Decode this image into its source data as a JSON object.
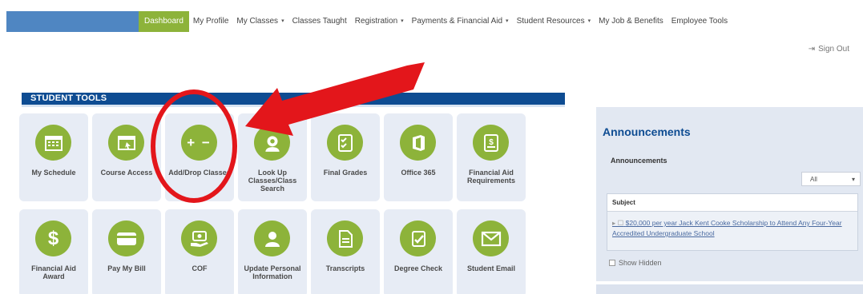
{
  "nav": {
    "items": [
      {
        "label": "Dashboard",
        "active": true,
        "dropdown": false
      },
      {
        "label": "My Profile",
        "dropdown": false
      },
      {
        "label": "My Classes",
        "dropdown": true
      },
      {
        "label": "Classes Taught",
        "dropdown": false
      },
      {
        "label": "Registration",
        "dropdown": true
      },
      {
        "label": "Payments & Financial Aid",
        "dropdown": true
      },
      {
        "label": "Student Resources",
        "dropdown": true
      },
      {
        "label": "My Job & Benefits",
        "dropdown": false
      },
      {
        "label": "Employee Tools",
        "dropdown": false
      }
    ],
    "caret": "▾",
    "sign_out": "Sign Out"
  },
  "tools": {
    "header": "STUDENT TOOLS",
    "row1": [
      {
        "label": "My Schedule",
        "icon": "calendar-icon"
      },
      {
        "label": "Course Access",
        "icon": "browser-window-icon"
      },
      {
        "label": "Add/Drop Classes",
        "icon": "plus-minus-icon"
      },
      {
        "label": "Look Up Classes/Class Search",
        "icon": "search-person-icon"
      },
      {
        "label": "Final Grades",
        "icon": "checklist-icon"
      },
      {
        "label": "Office 365",
        "icon": "office-icon"
      },
      {
        "label": "Financial Aid Requirements",
        "icon": "document-dollar-icon"
      }
    ],
    "row2": [
      {
        "label": "Financial Aid Award",
        "icon": "dollar-icon"
      },
      {
        "label": "Pay My Bill",
        "icon": "credit-card-icon"
      },
      {
        "label": "COF",
        "icon": "cash-hand-icon"
      },
      {
        "label": "Update Personal Information",
        "icon": "person-icon"
      },
      {
        "label": "Transcripts",
        "icon": "document-icon"
      },
      {
        "label": "Degree Check",
        "icon": "check-document-icon"
      },
      {
        "label": "Student Email",
        "icon": "envelope-icon"
      }
    ],
    "plus_minus_text": "+ −",
    "dollar_text": "$"
  },
  "announcements": {
    "title": "Announcements",
    "subtitle": "Announcements",
    "filter_value": "All",
    "filter_caret": "▾",
    "column_header": "Subject",
    "item_prefix": "▸ ☐",
    "item_text": "$20,000 per year Jack Kent Cooke Scholarship to Attend Any Four-Year Accredited Undergraduate School",
    "show_hidden": "Show Hidden"
  },
  "colors": {
    "accent_green": "#8db33a",
    "header_blue": "#0e4c92",
    "annotation_red": "#e3161b"
  }
}
